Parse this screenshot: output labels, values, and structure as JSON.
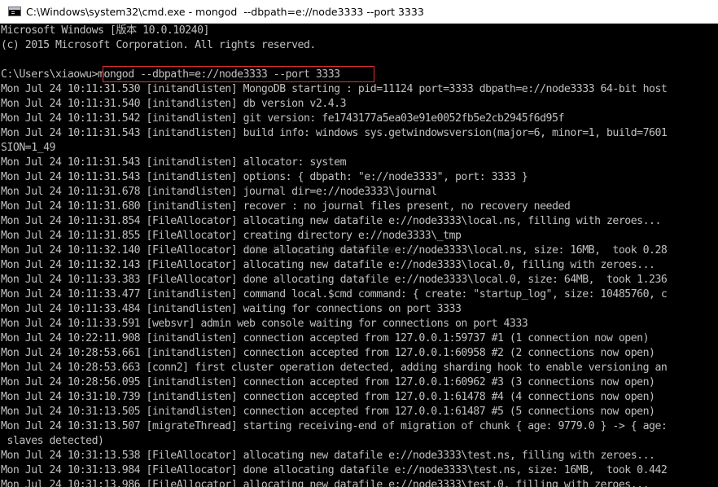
{
  "window": {
    "title": "C:\\Windows\\system32\\cmd.exe - mongod  --dbpath=e://node3333 --port 3333",
    "icon": "cmd-console-icon"
  },
  "console": {
    "lines": [
      "Microsoft Windows [版本 10.0.10240]",
      "(c) 2015 Microsoft Corporation. All rights reserved.",
      "",
      "C:\\Users\\xiaowu>mongod --dbpath=e://node3333 --port 3333",
      "Mon Jul 24 10:11:31.530 [initandlisten] MongoDB starting : pid=11124 port=3333 dbpath=e://node3333 64-bit host",
      "Mon Jul 24 10:11:31.540 [initandlisten] db version v2.4.3",
      "Mon Jul 24 10:11:31.542 [initandlisten] git version: fe1743177a5ea03e91e0052fb5e2cb2945f6d95f",
      "Mon Jul 24 10:11:31.543 [initandlisten] build info: windows sys.getwindowsversion(major=6, minor=1, build=7601",
      "SION=1_49",
      "Mon Jul 24 10:11:31.543 [initandlisten] allocator: system",
      "Mon Jul 24 10:11:31.543 [initandlisten] options: { dbpath: \"e://node3333\", port: 3333 }",
      "Mon Jul 24 10:11:31.678 [initandlisten] journal dir=e://node3333\\journal",
      "Mon Jul 24 10:11:31.680 [initandlisten] recover : no journal files present, no recovery needed",
      "Mon Jul 24 10:11:31.854 [FileAllocator] allocating new datafile e://node3333\\local.ns, filling with zeroes...",
      "Mon Jul 24 10:11:31.855 [FileAllocator] creating directory e://node3333\\_tmp",
      "Mon Jul 24 10:11:32.140 [FileAllocator] done allocating datafile e://node3333\\local.ns, size: 16MB,  took 0.28",
      "Mon Jul 24 10:11:32.143 [FileAllocator] allocating new datafile e://node3333\\local.0, filling with zeroes...",
      "Mon Jul 24 10:11:33.383 [FileAllocator] done allocating datafile e://node3333\\local.0, size: 64MB,  took 1.236",
      "Mon Jul 24 10:11:33.477 [initandlisten] command local.$cmd command: { create: \"startup_log\", size: 10485760, c",
      "Mon Jul 24 10:11:33.484 [initandlisten] waiting for connections on port 3333",
      "Mon Jul 24 10:11:33.591 [websvr] admin web console waiting for connections on port 4333",
      "Mon Jul 24 10:22:11.908 [initandlisten] connection accepted from 127.0.0.1:59737 #1 (1 connection now open)",
      "Mon Jul 24 10:28:53.661 [initandlisten] connection accepted from 127.0.0.1:60958 #2 (2 connections now open)",
      "Mon Jul 24 10:28:53.663 [conn2] first cluster operation detected, adding sharding hook to enable versioning an",
      "Mon Jul 24 10:28:56.095 [initandlisten] connection accepted from 127.0.0.1:60962 #3 (3 connections now open)",
      "Mon Jul 24 10:31:10.739 [initandlisten] connection accepted from 127.0.0.1:61478 #4 (4 connections now open)",
      "Mon Jul 24 10:31:13.505 [initandlisten] connection accepted from 127.0.0.1:61487 #5 (5 connections now open)",
      "Mon Jul 24 10:31:13.507 [migrateThread] starting receiving-end of migration of chunk { age: 9779.0 } -> { age:",
      " slaves detected)",
      "Mon Jul 24 10:31:13.538 [FileAllocator] allocating new datafile e://node3333\\test.ns, filling with zeroes...",
      "Mon Jul 24 10:31:13.984 [FileAllocator] done allocating datafile e://node3333\\test.ns, size: 16MB,  took 0.442",
      "Mon Jul 24 10:31:13.986 [FileAllocator] allocating new datafile e://node3333\\test.0, filling with zeroes..."
    ]
  },
  "watermark": "http://blog.csdn.net/lwe_wang",
  "colors": {
    "console_bg": "#000000",
    "console_fg": "#c0c0c0",
    "highlight_box": "#e03030"
  }
}
